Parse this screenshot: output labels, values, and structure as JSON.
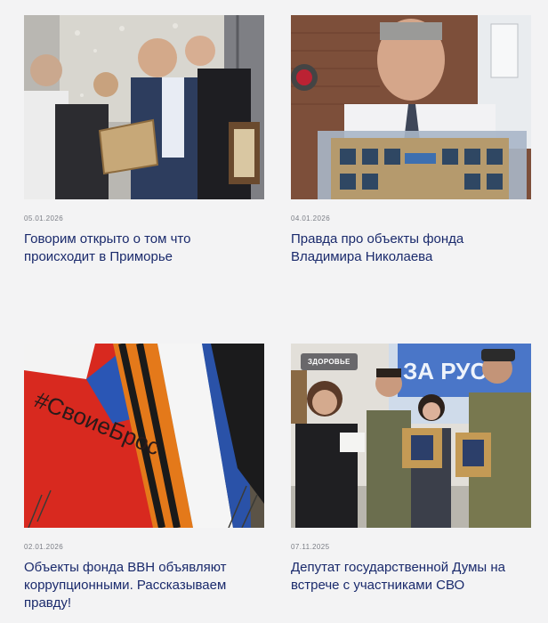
{
  "news": [
    {
      "date": "05.01.2026",
      "title": "Говорим открыто о том что происходит в Приморье",
      "image": "award-ceremony-photo"
    },
    {
      "date": "04.01.2026",
      "title": "Правда про объекты фонда Владимира Николаева",
      "image": "interview-man-photo"
    },
    {
      "date": "02.01.2026",
      "title": "Объекты фонда ВВН объявляют коррупционными. Рассказываем правду!",
      "image": "flags-photo",
      "flag_text": "#СвоиеБрос"
    },
    {
      "date": "07.11.2025",
      "title": "Депутат государственной Думы на встрече с участниками СВО",
      "badge": "ЗДОРОВЬЕ",
      "image": "deputy-meeting-photo",
      "banner_text": "ЗА РУС"
    }
  ],
  "colors": {
    "title": "#1a2a6c",
    "date": "#7a7d85",
    "background": "#f3f3f4"
  }
}
